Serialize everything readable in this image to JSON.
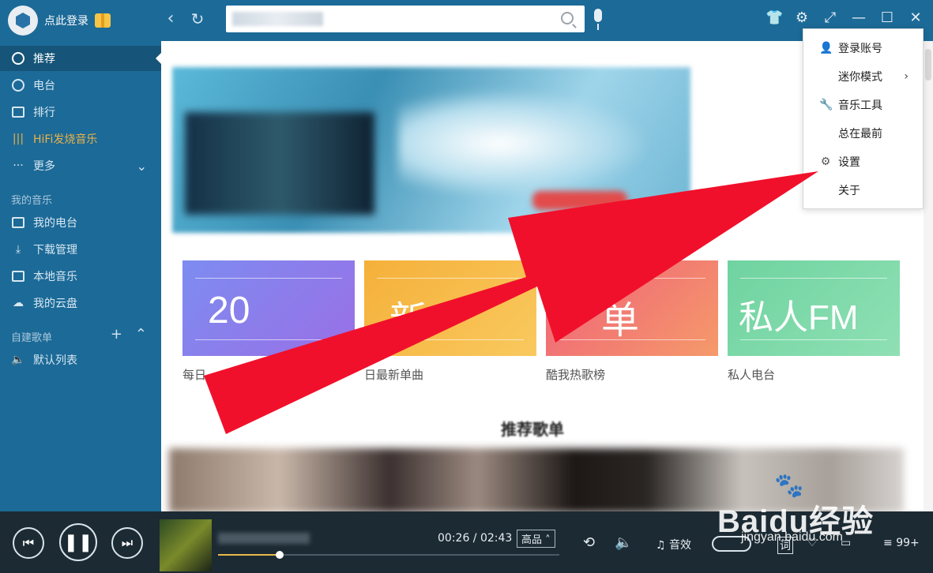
{
  "header": {
    "login_text": "点此登录",
    "back_icon": "chevron-left-icon",
    "refresh_icon": "refresh-icon",
    "search_placeholder": "",
    "window_controls": [
      "shirt-icon",
      "gear-icon",
      "mini-mode-icon",
      "minimize-icon",
      "maximize-icon",
      "close-icon"
    ]
  },
  "sidebar": {
    "items": [
      {
        "label": "推荐",
        "icon": "music-note-icon",
        "active": true
      },
      {
        "label": "电台",
        "icon": "radio-icon"
      },
      {
        "label": "排行",
        "icon": "chart-icon"
      },
      {
        "label": "HiFi发烧音乐",
        "icon": "hifi-wave-icon"
      },
      {
        "label": "更多",
        "icon": "dots-icon"
      }
    ],
    "my_music_title": "我的音乐",
    "my_music": [
      {
        "label": "我的电台",
        "icon": "radio-box-icon"
      },
      {
        "label": "下载管理",
        "icon": "download-icon"
      },
      {
        "label": "本地音乐",
        "icon": "monitor-icon"
      },
      {
        "label": "我的云盘",
        "icon": "cloud-icon"
      }
    ],
    "playlist_title": "自建歌单",
    "playlists": [
      {
        "label": "默认列表",
        "icon": "speaker-icon"
      }
    ]
  },
  "content": {
    "cards": [
      {
        "title": "20",
        "caption": "每日",
        "color_from": "#7d8cf0",
        "color_to": "#9a6fe6"
      },
      {
        "title": "新",
        "caption": "日最新单曲",
        "color_from": "#f5b03a",
        "color_to": "#f9c95e"
      },
      {
        "title": "单",
        "caption": "酷我热歌榜",
        "color_from": "#ef5f7a",
        "color_to": "#f59a6a"
      },
      {
        "title": "私人FM",
        "caption": "私人电台",
        "color_from": "#6fd3a0",
        "color_to": "#8fe0b4"
      }
    ],
    "section_title": "推荐歌单"
  },
  "menu": {
    "items": [
      {
        "label": "登录账号",
        "icon": "user-icon"
      },
      {
        "label": "迷你模式",
        "icon": "",
        "submenu": true
      },
      {
        "label": "音乐工具",
        "icon": "wrench-icon"
      },
      {
        "label": "总在最前",
        "icon": ""
      },
      {
        "label": "设置",
        "icon": "gear-icon"
      },
      {
        "label": "关于",
        "icon": ""
      }
    ]
  },
  "player": {
    "time_current": "00:26",
    "time_total": "02:43",
    "quality": "高品",
    "progress": 0.18,
    "sound_effect": "音效",
    "lyrics_short": "词",
    "count": "99+"
  },
  "watermark": {
    "main": "Baidu经验",
    "sub": "jingyan.baidu.com"
  },
  "colors": {
    "sidebar_bg": "#1c6a97",
    "player_bg": "#1c2a33",
    "arrow": "#f1102b",
    "accent_gold": "#e8b949"
  }
}
